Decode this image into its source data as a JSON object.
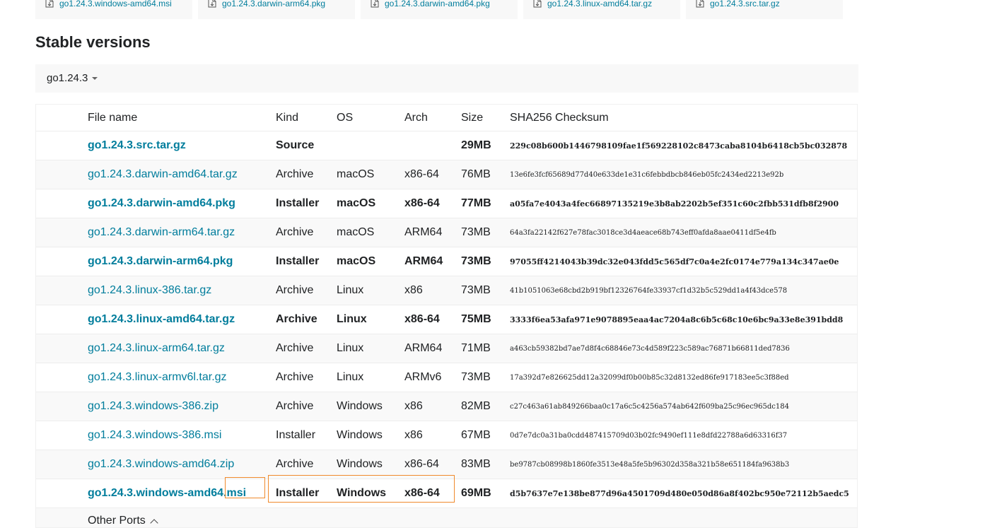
{
  "featured_downloads": [
    {
      "label": "go1.24.3.windows-amd64.msi"
    },
    {
      "label": "go1.24.3.darwin-arm64.pkg"
    },
    {
      "label": "go1.24.3.darwin-amd64.pkg"
    },
    {
      "label": "go1.24.3.linux-amd64.tar.gz"
    },
    {
      "label": "go1.24.3.src.tar.gz"
    }
  ],
  "section_title": "Stable versions",
  "version_selector": {
    "label": "go1.24.3"
  },
  "table": {
    "headers": {
      "file": "File name",
      "kind": "Kind",
      "os": "OS",
      "arch": "Arch",
      "size": "Size",
      "sha": "SHA256 Checksum"
    },
    "rows": [
      {
        "file": "go1.24.3.src.tar.gz",
        "kind": "Source",
        "os": "",
        "arch": "",
        "size": "29MB",
        "sha": "229c08b600b1446798109fae1f569228102c8473caba8104b6418cb5bc032878",
        "highlight": true
      },
      {
        "file": "go1.24.3.darwin-amd64.tar.gz",
        "kind": "Archive",
        "os": "macOS",
        "arch": "x86-64",
        "size": "76MB",
        "sha": "13e6fe3fcf65689d77d40e633de1e31c6febbdbcb846eb05fc2434ed2213e92b",
        "highlight": false
      },
      {
        "file": "go1.24.3.darwin-amd64.pkg",
        "kind": "Installer",
        "os": "macOS",
        "arch": "x86-64",
        "size": "77MB",
        "sha": "a05fa7e4043a4fec66897135219e3b8ab2202b5ef351c60c2fbb531dfb8f2900",
        "highlight": true
      },
      {
        "file": "go1.24.3.darwin-arm64.tar.gz",
        "kind": "Archive",
        "os": "macOS",
        "arch": "ARM64",
        "size": "73MB",
        "sha": "64a3fa22142f627e78fac3018ce3d4aeace68b743eff0afda8aae0411df5e4fb",
        "highlight": false
      },
      {
        "file": "go1.24.3.darwin-arm64.pkg",
        "kind": "Installer",
        "os": "macOS",
        "arch": "ARM64",
        "size": "73MB",
        "sha": "97055ff4214043b39dc32e043fdd5c565df7c0a4e2fc0174e779a134c347ae0e",
        "highlight": true
      },
      {
        "file": "go1.24.3.linux-386.tar.gz",
        "kind": "Archive",
        "os": "Linux",
        "arch": "x86",
        "size": "73MB",
        "sha": "41b1051063e68cbd2b919bf12326764fe33937cf1d32b5c529dd1a4f43dce578",
        "highlight": false
      },
      {
        "file": "go1.24.3.linux-amd64.tar.gz",
        "kind": "Archive",
        "os": "Linux",
        "arch": "x86-64",
        "size": "75MB",
        "sha": "3333f6ea53afa971e9078895eaa4ac7204a8c6b5c68c10e6bc9a33e8e391bdd8",
        "highlight": true
      },
      {
        "file": "go1.24.3.linux-arm64.tar.gz",
        "kind": "Archive",
        "os": "Linux",
        "arch": "ARM64",
        "size": "71MB",
        "sha": "a463cb59382bd7ae7d8f4c68846e73c4d589f223c589ac76871b66811ded7836",
        "highlight": false
      },
      {
        "file": "go1.24.3.linux-armv6l.tar.gz",
        "kind": "Archive",
        "os": "Linux",
        "arch": "ARMv6",
        "size": "73MB",
        "sha": "17a392d7e826625dd12a32099df0b00b85c32d8132ed86fe917183ee5c3f88ed",
        "highlight": false
      },
      {
        "file": "go1.24.3.windows-386.zip",
        "kind": "Archive",
        "os": "Windows",
        "arch": "x86",
        "size": "82MB",
        "sha": "c27c463a61ab849266baa0c17a6c5c4256a574ab642f609ba25c96ec965dc184",
        "highlight": false
      },
      {
        "file": "go1.24.3.windows-386.msi",
        "kind": "Installer",
        "os": "Windows",
        "arch": "x86",
        "size": "67MB",
        "sha": "0d7e7dc0a31ba0cdd487415709d03b02fc9490ef111e8dfd22788a6d63316f37",
        "highlight": false
      },
      {
        "file": "go1.24.3.windows-amd64.zip",
        "kind": "Archive",
        "os": "Windows",
        "arch": "x86-64",
        "size": "83MB",
        "sha": "be9787cb08998b1860fe3513e48a5fe5b96302d358a321b58e651184fa9638b3",
        "highlight": false
      },
      {
        "file": "go1.24.3.windows-amd64.msi",
        "kind": "Installer",
        "os": "Windows",
        "arch": "x86-64",
        "size": "69MB",
        "sha": "d5b7637e7e138be877d96a4501709d480e050d86a8f402bc950e72112b5aedc5",
        "highlight": true
      }
    ]
  },
  "other_ports": {
    "label": "Other Ports"
  },
  "colors": {
    "link": "#007d9c",
    "annotation": "#f08a2c"
  }
}
